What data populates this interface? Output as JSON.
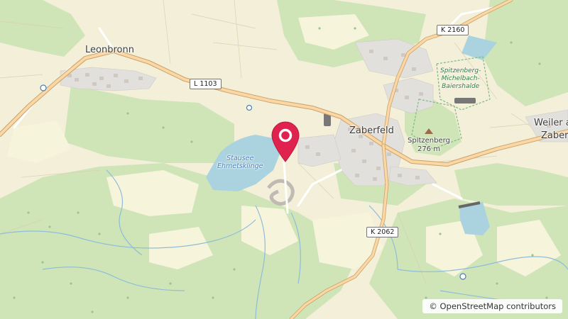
{
  "map": {
    "places": {
      "leonbronn": "Leonbronn",
      "zaberfeld": "Zaberfeld",
      "weiler": "Weiler a",
      "weiler_2": "Zaber"
    },
    "roads": {
      "l1103": "L 1103",
      "k2160": "K 2160",
      "k2062": "K 2062"
    },
    "water": {
      "stausee_line1": "Stausee",
      "stausee_line2": "Ehmetsklinge"
    },
    "park": {
      "line1": "Spitzenberg-",
      "line2": "Michelbach-",
      "line3": "Baiershalde"
    },
    "peak": {
      "name": "Spitzenberg",
      "elevation": "276 m"
    },
    "attribution": "© OpenStreetMap contributors"
  },
  "colors": {
    "forest": "#cde4b5",
    "meadow": "#f5f2d4",
    "water": "#aad3df",
    "road_main": "#fcd6a4",
    "residential": "#e0dfdf",
    "marker": "#e0224f"
  }
}
